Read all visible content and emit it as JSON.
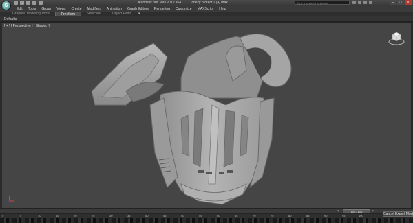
{
  "window": {
    "app_title": "Autodesk 3ds Max 2012 x64",
    "file_name": "chezy protect 1 (4).max",
    "search_placeholder": "Type a keyword or phrase",
    "logo_letter": "S"
  },
  "menu": {
    "items": [
      "Edit",
      "Tools",
      "Group",
      "Views",
      "Create",
      "Modifiers",
      "Animation",
      "Graph Editors",
      "Rendering",
      "Customize",
      "MAXScript",
      "Help"
    ]
  },
  "ribbon": {
    "tabs": [
      "Graphite Modeling Tools",
      "Freeform",
      "Selection",
      "Object Paint"
    ],
    "active_tab": "Freeform",
    "dropdown": "▾"
  },
  "defaults_label": "Defaults",
  "viewport": {
    "label": "[ + ] [ Perspective ] [ Shaded ]"
  },
  "timeline": {
    "frame_readout": "100 / 100",
    "prev_arrow": "<",
    "next_arrow": ">",
    "ticks": [
      "0",
      "5",
      "10",
      "15",
      "20",
      "25",
      "30",
      "35",
      "40",
      "45",
      "50",
      "55",
      "60",
      "65",
      "70",
      "75",
      "80",
      "85",
      "90",
      "95",
      "100"
    ]
  },
  "status": {
    "cancel_expert_mode": "Cancel Expert Mode"
  },
  "colors": {
    "viewport_bg": "#454545",
    "model_gray": "#a9a9a9",
    "logo_teal": "#2f7f7a"
  }
}
